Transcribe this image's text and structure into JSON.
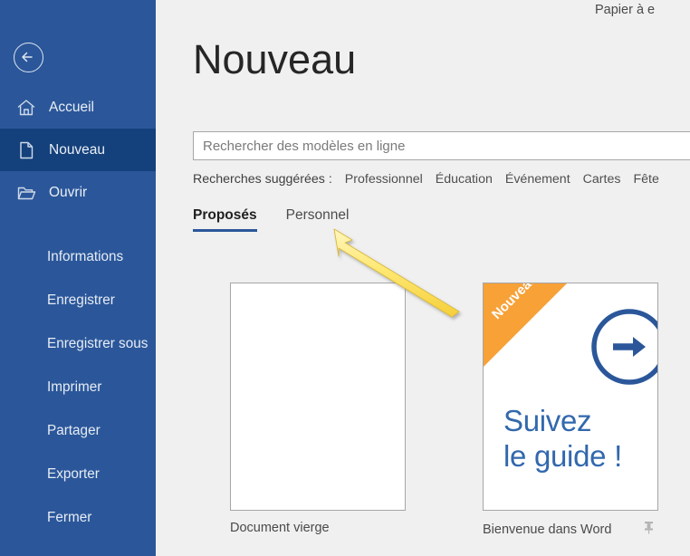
{
  "window": {
    "top_right_label": "Papier à e"
  },
  "sidebar": {
    "background_color": "#2b579a",
    "active_color": "#14417c",
    "back_button": {
      "name": "back-arrow-icon"
    },
    "top_items": [
      {
        "label": "Accueil",
        "icon": "home-icon",
        "active": false
      },
      {
        "label": "Nouveau",
        "icon": "document-icon",
        "active": true
      },
      {
        "label": "Ouvrir",
        "icon": "folder-open-icon",
        "active": false
      }
    ],
    "items": [
      {
        "label": "Informations"
      },
      {
        "label": "Enregistrer"
      },
      {
        "label": "Enregistrer sous"
      },
      {
        "label": "Imprimer"
      },
      {
        "label": "Partager"
      },
      {
        "label": "Exporter"
      },
      {
        "label": "Fermer"
      }
    ]
  },
  "main": {
    "title": "Nouveau",
    "search": {
      "placeholder": "Rechercher des modèles en ligne",
      "value": "",
      "icon": "search-icon"
    },
    "suggested": {
      "label": "Recherches suggérées :",
      "links": [
        "Professionnel",
        "Éducation",
        "Événement",
        "Cartes",
        "Fête"
      ]
    },
    "tabs": [
      {
        "label": "Proposés",
        "active": true
      },
      {
        "label": "Personnel",
        "active": false
      }
    ],
    "templates": [
      {
        "caption": "Document vierge",
        "badge": null,
        "pinned": false
      },
      {
        "caption": "Bienvenue dans Word",
        "badge": "Nouveau",
        "badge_color": "#f7a137",
        "thumb_heading_line1": "Suivez",
        "thumb_heading_line2": "le guide !",
        "thumb_text_color": "#3268ad",
        "pinned": true,
        "pin_icon": "pin-icon"
      }
    ]
  },
  "annotation": {
    "arrow_color": "#ffe680",
    "arrow_name": "yellow-pointer-arrow",
    "points_to": "Personnel"
  }
}
